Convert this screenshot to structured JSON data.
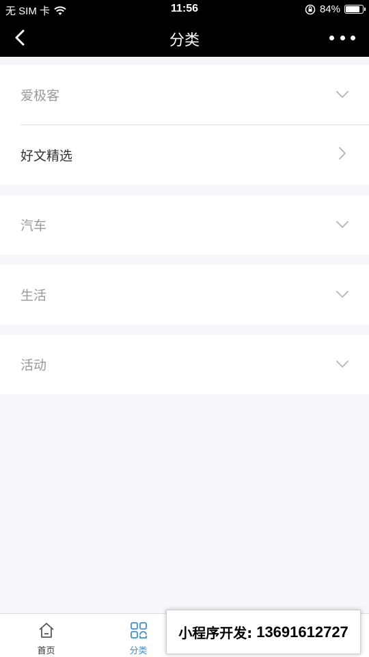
{
  "status_bar": {
    "carrier": "无 SIM 卡",
    "time": "11:56",
    "battery_percent": "84%",
    "battery_level": 0.84
  },
  "nav": {
    "title": "分类"
  },
  "categories": [
    {
      "label": "爱极客",
      "expanded": true,
      "children": [
        {
          "label": "好文精选"
        }
      ]
    },
    {
      "label": "汽车",
      "expanded": false
    },
    {
      "label": "生活",
      "expanded": false
    },
    {
      "label": "活动",
      "expanded": false
    }
  ],
  "tab_bar": {
    "tabs": [
      {
        "label": "首页",
        "icon": "home-icon",
        "active": false
      },
      {
        "label": "分类",
        "icon": "category-grid-icon",
        "active": true
      },
      {
        "label": "",
        "icon": "",
        "active": false
      },
      {
        "label": "",
        "icon": "",
        "active": false
      }
    ]
  },
  "overlay": {
    "text": "小程序开发:",
    "phone": "13691612727"
  },
  "colors": {
    "active_tab": "#3a8ee6",
    "background": "#f7f6fb",
    "nav_bg": "#000000"
  }
}
